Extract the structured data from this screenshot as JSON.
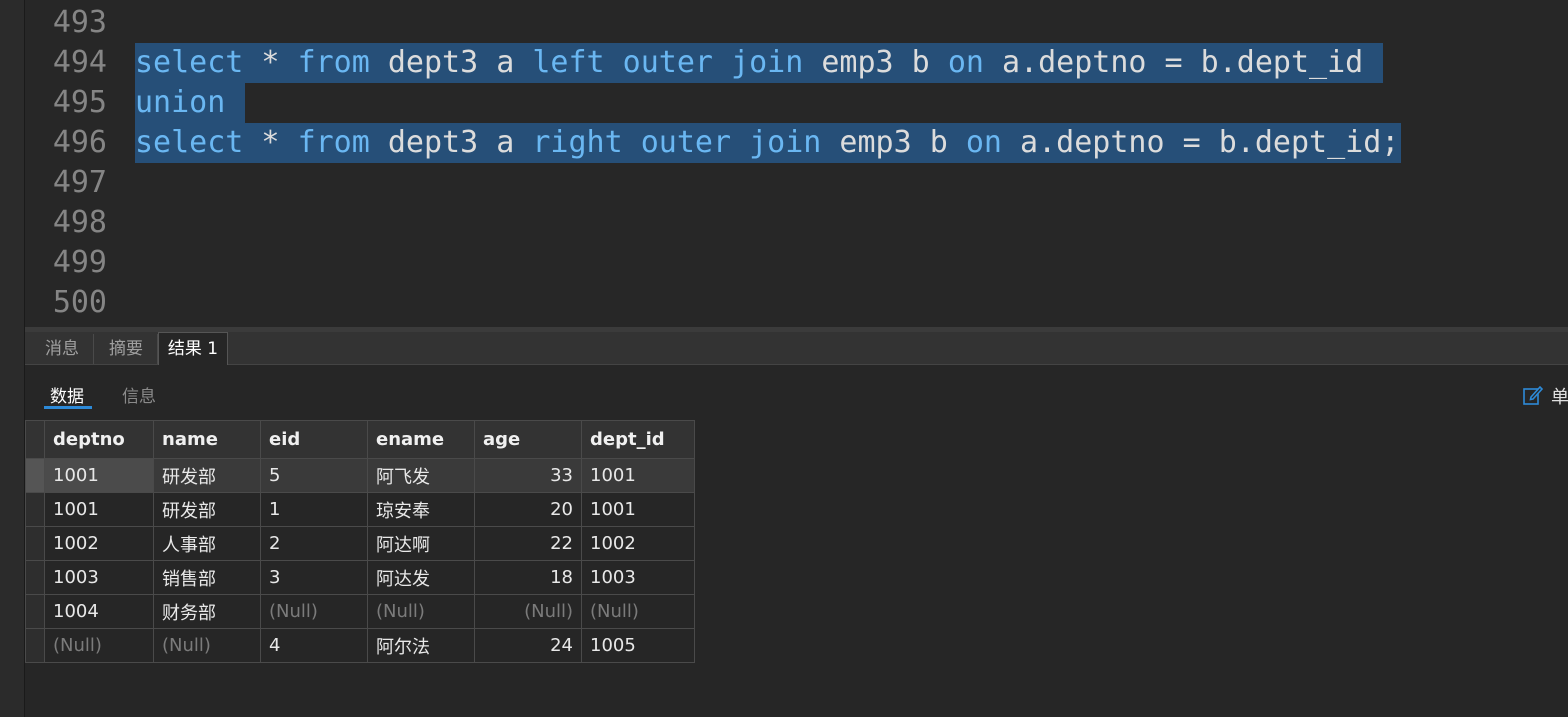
{
  "editor": {
    "lines": [
      {
        "no": "493",
        "tokens": []
      },
      {
        "no": "494",
        "tokens": [
          [
            "kw",
            "select"
          ],
          [
            "t",
            " * "
          ],
          [
            "kw",
            "from"
          ],
          [
            "t",
            " dept3 a "
          ],
          [
            "kw",
            "left outer join"
          ],
          [
            "t",
            " emp3 b "
          ],
          [
            "kw",
            "on"
          ],
          [
            "t",
            " a.deptno = b.dept_id "
          ]
        ]
      },
      {
        "no": "495",
        "tokens": [
          [
            "kw",
            "union"
          ],
          [
            "t",
            " "
          ]
        ]
      },
      {
        "no": "496",
        "tokens": [
          [
            "kw",
            "select"
          ],
          [
            "t",
            " * "
          ],
          [
            "kw",
            "from"
          ],
          [
            "t",
            " dept3 a "
          ],
          [
            "kw",
            "right outer join"
          ],
          [
            "t",
            " emp3 b "
          ],
          [
            "kw",
            "on"
          ],
          [
            "t",
            " a.deptno = b.dept_id;"
          ]
        ]
      },
      {
        "no": "497",
        "tokens": []
      },
      {
        "no": "498",
        "tokens": []
      },
      {
        "no": "499",
        "tokens": []
      },
      {
        "no": "500",
        "tokens": []
      }
    ]
  },
  "result_tabs": [
    {
      "label": "消息",
      "active": false
    },
    {
      "label": "摘要",
      "active": false
    },
    {
      "label": "结果 1",
      "active": true
    }
  ],
  "sub_tabs": [
    {
      "label": "数据",
      "active": true
    },
    {
      "label": "信息",
      "active": false
    }
  ],
  "edit_label": "单",
  "grid": {
    "columns": [
      "deptno",
      "name",
      "eid",
      "ename",
      "age",
      "dept_id"
    ],
    "rows": [
      [
        "1001",
        "研发部",
        "5",
        "阿飞发",
        "33",
        "1001"
      ],
      [
        "1001",
        "研发部",
        "1",
        "琼安奉",
        "20",
        "1001"
      ],
      [
        "1002",
        "人事部",
        "2",
        "阿达啊",
        "22",
        "1002"
      ],
      [
        "1003",
        "销售部",
        "3",
        "阿达发",
        "18",
        "1003"
      ],
      [
        "1004",
        "财务部",
        "(Null)",
        "(Null)",
        "(Null)",
        "(Null)"
      ],
      [
        "(Null)",
        "(Null)",
        "4",
        "阿尔法",
        "24",
        "1005"
      ]
    ]
  },
  "colors": {
    "keyword": "#6ab7f2",
    "selection": "#264f78",
    "accent": "#2d8ad8",
    "null_text": "#7b7b7b"
  }
}
